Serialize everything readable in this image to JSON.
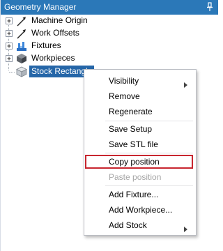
{
  "window": {
    "title": "Geometry Manager",
    "pin_icon": "pin-icon"
  },
  "tree": {
    "items": [
      {
        "label": "Machine Origin",
        "icon": "axis-arrow-icon",
        "expanded": false
      },
      {
        "label": "Work Offsets",
        "icon": "axis-arrow-icon",
        "expanded": false
      },
      {
        "label": "Fixtures",
        "icon": "fixture-icon",
        "expanded": false
      },
      {
        "label": "Workpieces",
        "icon": "workpiece-icon",
        "expanded": false
      },
      {
        "label": "Stock Rectangle",
        "icon": "stock-box-icon",
        "selected": true
      }
    ]
  },
  "context_menu": {
    "items": [
      {
        "label": "Visibility",
        "submenu": true,
        "enabled": true
      },
      {
        "label": "Remove",
        "enabled": true
      },
      {
        "label": "Regenerate",
        "enabled": true
      },
      {
        "label": "Save Setup",
        "enabled": true
      },
      {
        "label": "Save STL file",
        "enabled": true
      },
      {
        "label": "Copy position",
        "enabled": true,
        "highlighted": true
      },
      {
        "label": "Paste position",
        "enabled": false
      },
      {
        "label": "Add Fixture...",
        "enabled": true
      },
      {
        "label": "Add Workpiece...",
        "enabled": true
      },
      {
        "label": "Add Stock",
        "submenu": true,
        "enabled": true
      }
    ]
  },
  "colors": {
    "titlebar": "#2b78b8",
    "selection": "#2566a8",
    "highlight_border": "#c8262f",
    "disabled_text": "#a6a6a6"
  }
}
